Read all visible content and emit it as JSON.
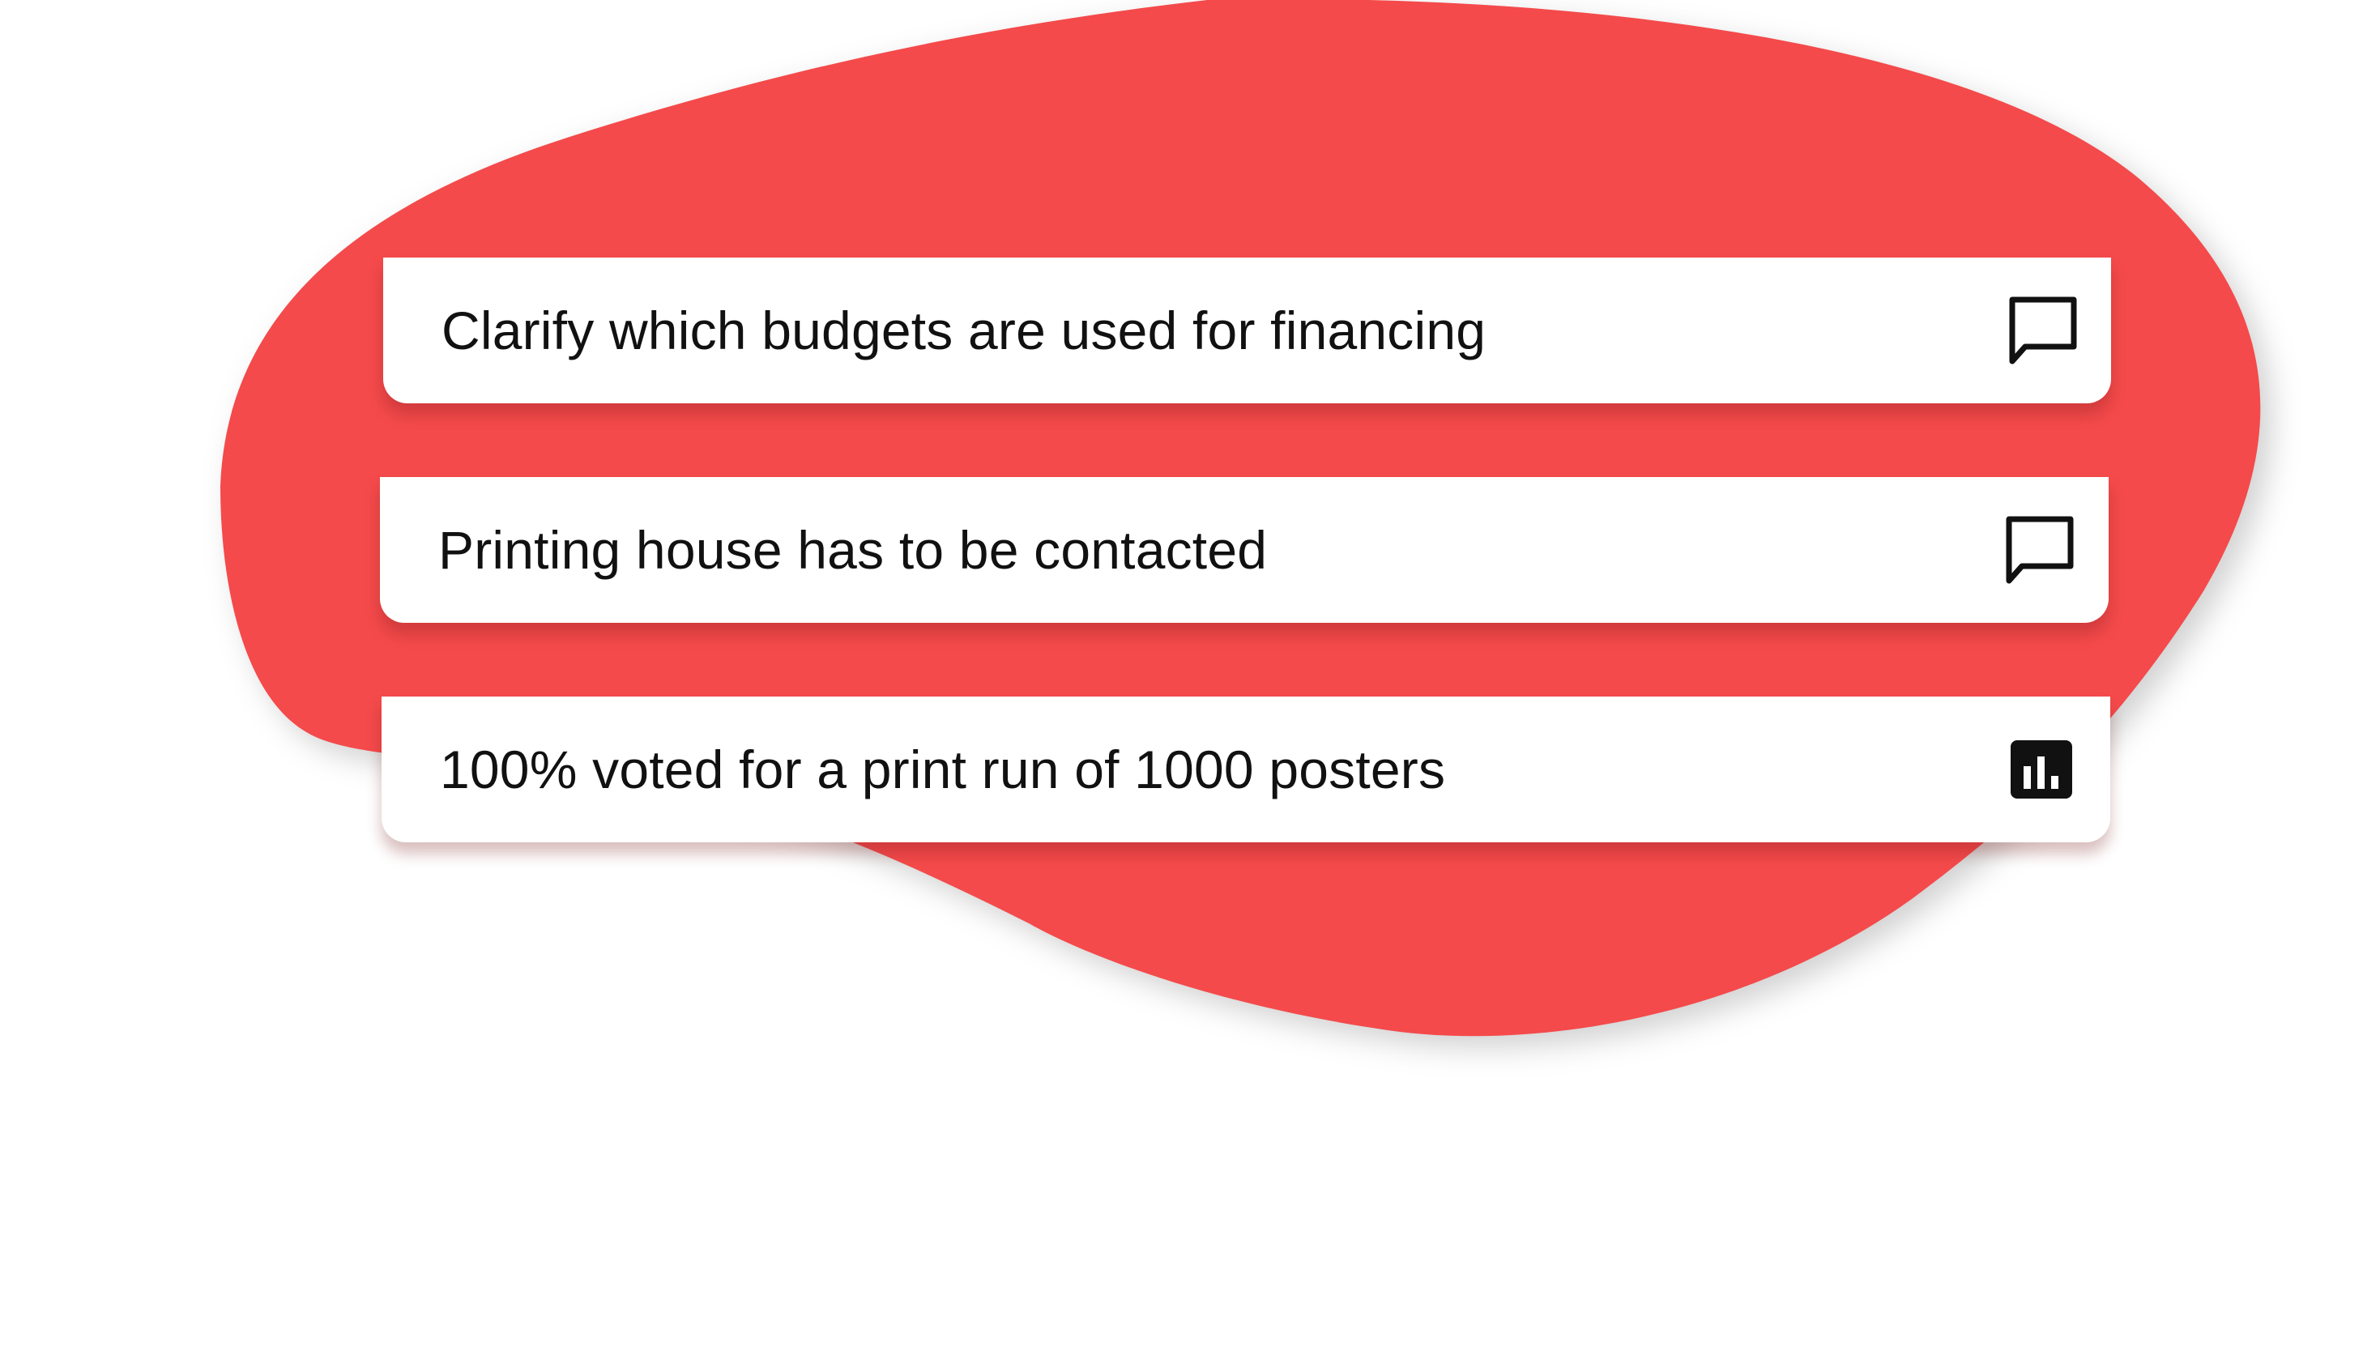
{
  "colors": {
    "blob": "#f44a4b",
    "card_background": "#ffffff",
    "text": "#111111",
    "icon": "#111111"
  },
  "cards": [
    {
      "text": "Clarify which budgets are used for financing",
      "icon": "comment-icon"
    },
    {
      "text": "Printing house has to be contacted",
      "icon": "comment-icon"
    },
    {
      "text": "100% voted for a print run of 1000 posters",
      "icon": "poll-icon"
    }
  ]
}
